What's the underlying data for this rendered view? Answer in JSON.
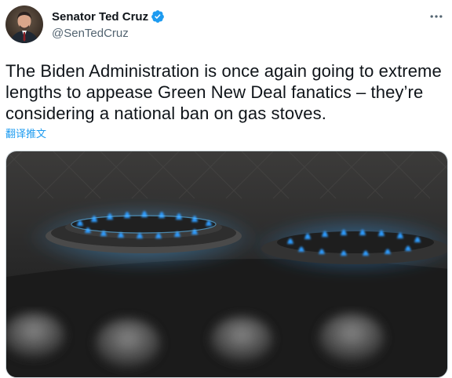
{
  "author": {
    "display_name": "Senator Ted Cruz",
    "handle": "@SenTedCruz",
    "verified": true
  },
  "tweet": {
    "text": "The Biden Administration is once again going to extreme lengths to appease Green New Deal fanatics – they’re considering a national ban on gas stoves.",
    "translate_label": "翻译推文"
  },
  "icons": {
    "verified": "verified-badge-icon",
    "more": "more-options-icon"
  },
  "colors": {
    "accent": "#1d9bf0",
    "text": "#0f1419",
    "secondary": "#536471"
  }
}
